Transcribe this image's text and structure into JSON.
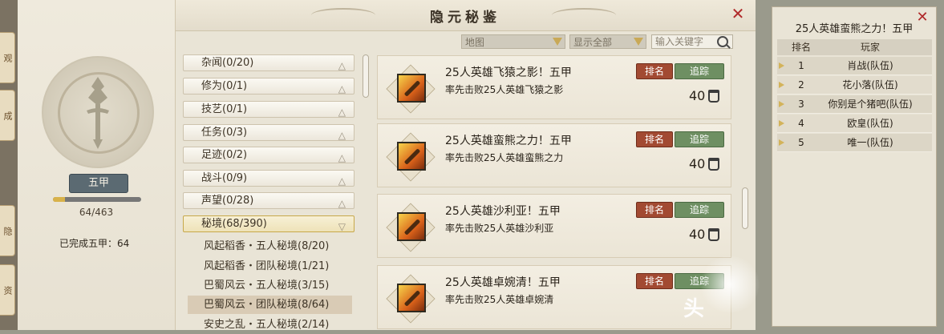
{
  "left_strip": {
    "tabs": [
      "观",
      "成",
      "隐",
      "资"
    ]
  },
  "window": {
    "title": "隐元秘鉴",
    "close_glyph": "✕"
  },
  "profile": {
    "rank": "五甲",
    "progress_text": "64/463",
    "progress_fraction": 0.138,
    "completed_label": "已完成五甲：64"
  },
  "filters": {
    "map_dropdown": "地图",
    "show_dropdown": "显示全部",
    "search_placeholder": "输入关键字"
  },
  "categories": [
    {
      "label": "杂闻(0/20)",
      "arrow": "△"
    },
    {
      "label": "修为(0/1)",
      "arrow": "△"
    },
    {
      "label": "技艺(0/1)",
      "arrow": "△"
    },
    {
      "label": "任务(0/3)",
      "arrow": "△"
    },
    {
      "label": "足迹(0/2)",
      "arrow": "△"
    },
    {
      "label": "战斗(0/9)",
      "arrow": "△"
    },
    {
      "label": "声望(0/28)",
      "arrow": "△"
    },
    {
      "label": "秘境(68/390)",
      "arrow": "▽"
    }
  ],
  "sub_categories": [
    "风起稻香・五人秘境(8/20)",
    "风起稻香・团队秘境(1/21)",
    "巴蜀风云・五人秘境(3/15)",
    "巴蜀风云・团队秘境(8/64)",
    "安史之乱・五人秘境(2/14)"
  ],
  "achievements": [
    {
      "title": "25人英雄飞猿之影！五甲",
      "desc": "率先击败25人英雄飞猿之影",
      "points": "40",
      "rank_label": "排名",
      "track_label": "追踪"
    },
    {
      "title": "25人英雄蛮熊之力！五甲",
      "desc": "率先击败25人英雄蛮熊之力",
      "points": "40",
      "rank_label": "排名",
      "track_label": "追踪"
    },
    {
      "title": "25人英雄沙利亚！五甲",
      "desc": "率先击败25人英雄沙利亚",
      "points": "40",
      "rank_label": "排名",
      "track_label": "追踪"
    },
    {
      "title": "25人英雄卓婉清！五甲",
      "desc": "率先击败25人英雄卓婉清",
      "points": "",
      "rank_label": "排名",
      "track_label": "追踪"
    }
  ],
  "watermark": "头",
  "ranking": {
    "title": "25人英雄蛮熊之力！五甲",
    "close_glyph": "✕",
    "col_rank": "排名",
    "col_player": "玩家",
    "rows": [
      {
        "no": "1",
        "name": "肖战(队伍)"
      },
      {
        "no": "2",
        "name": "花小落(队伍)"
      },
      {
        "no": "3",
        "name": "你别是个猪吧(队伍)"
      },
      {
        "no": "4",
        "name": "欧皇(队伍)"
      },
      {
        "no": "5",
        "name": "唯一(队伍)"
      }
    ]
  }
}
